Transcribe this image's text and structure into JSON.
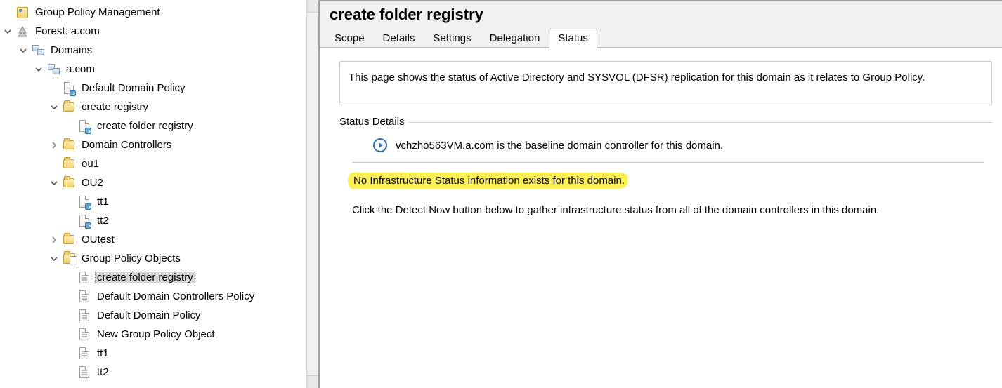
{
  "tree": {
    "root": "Group Policy Management",
    "forest": "Forest: a.com",
    "domains": "Domains",
    "domain": "a.com",
    "ddp": "Default Domain Policy",
    "cr": "create registry",
    "cfr": "create folder registry",
    "dc": "Domain Controllers",
    "ou1": "ou1",
    "ou2": "OU2",
    "tt1": "tt1",
    "tt2": "tt2",
    "outest": "OUtest",
    "gpoContainer": "Group Policy Objects",
    "gpo_cfr": "create folder registry",
    "gpo_ddcp": "Default Domain Controllers Policy",
    "gpo_ddp": "Default Domain Policy",
    "gpo_new": "New Group Policy Object",
    "gpo_tt1": "tt1",
    "gpo_tt2": "tt2"
  },
  "header": {
    "title": "create folder registry"
  },
  "tabs": {
    "scope": "Scope",
    "details": "Details",
    "settings": "Settings",
    "delegation": "Delegation",
    "status": "Status"
  },
  "status": {
    "intro": "This page shows the status of Active Directory and SYSVOL (DFSR) replication for this domain as it relates to Group Policy.",
    "legend": "Status Details",
    "baseline": "vchzho563VM.a.com is the baseline domain controller for this domain.",
    "noinfo": "No Infrastructure Status information exists for this domain.",
    "instruction": "Click the Detect Now button below to gather infrastructure status from all of the domain controllers in this domain."
  }
}
